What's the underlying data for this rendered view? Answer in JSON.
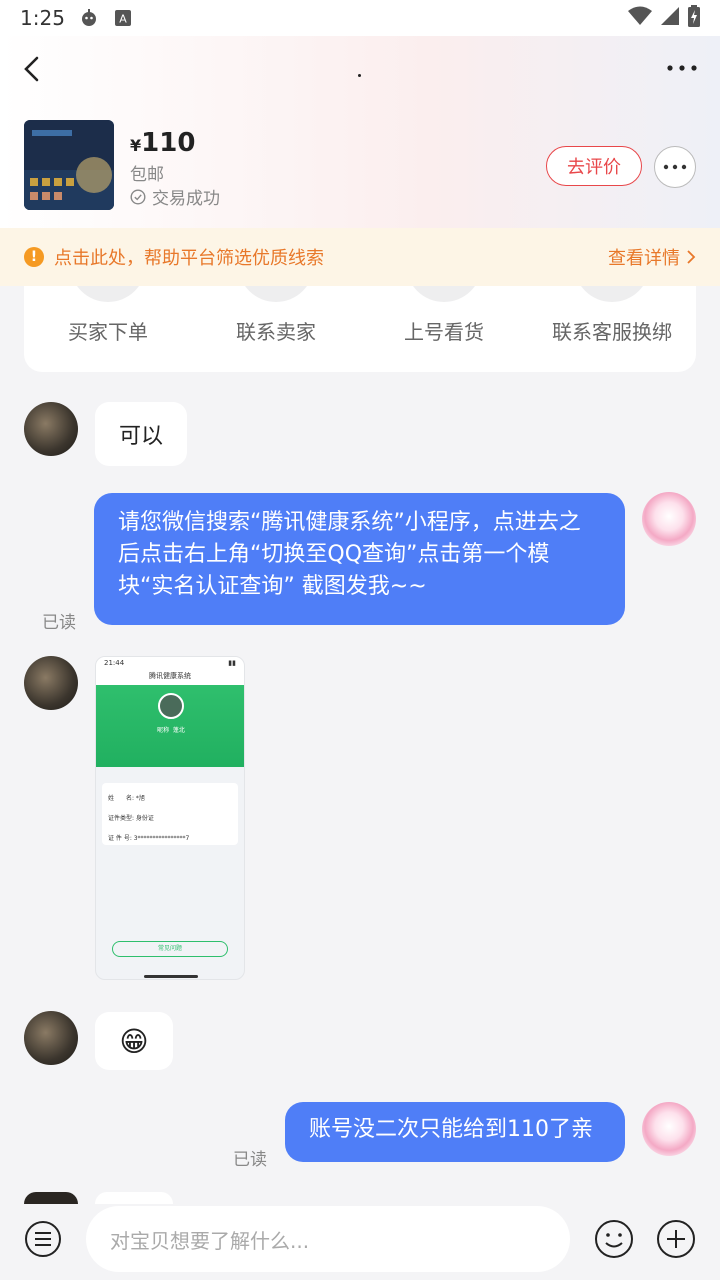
{
  "status_bar": {
    "time": "1:25"
  },
  "header": {
    "title": "."
  },
  "product": {
    "price_symbol": "¥",
    "price": "110",
    "shipping": "包邮",
    "status": "交易成功",
    "rate_label": "去评价"
  },
  "notice": {
    "text": "点击此处，帮助平台筛选优质线索",
    "link": "查看详情"
  },
  "actions": [
    {
      "label": "买家下单"
    },
    {
      "label": "联系卖家"
    },
    {
      "label": "上号看货"
    },
    {
      "label": "联系客服换绑"
    }
  ],
  "messages": {
    "m1": "可以",
    "m2": "请您微信搜索“腾讯健康系统”小程序，点进去之后点击右上角“切换至QQ查询”点击第一个模块“实名认证查询” 截图发我~~",
    "m2_read": "已读",
    "m3_emoji": "😁",
    "m4": "账号没二次只能给到110了亲",
    "m4_read": "已读"
  },
  "screenshot": {
    "time": "21:44",
    "title": "腾讯健康系统",
    "nick_label": "昵称",
    "nick": "蓬北",
    "field1": "姓　　名: *旭",
    "field2": "证件类型: 身份证",
    "field3": "证 件 号: 3****************7",
    "button": "常见问题"
  },
  "input": {
    "placeholder": "对宝贝想要了解什么..."
  }
}
